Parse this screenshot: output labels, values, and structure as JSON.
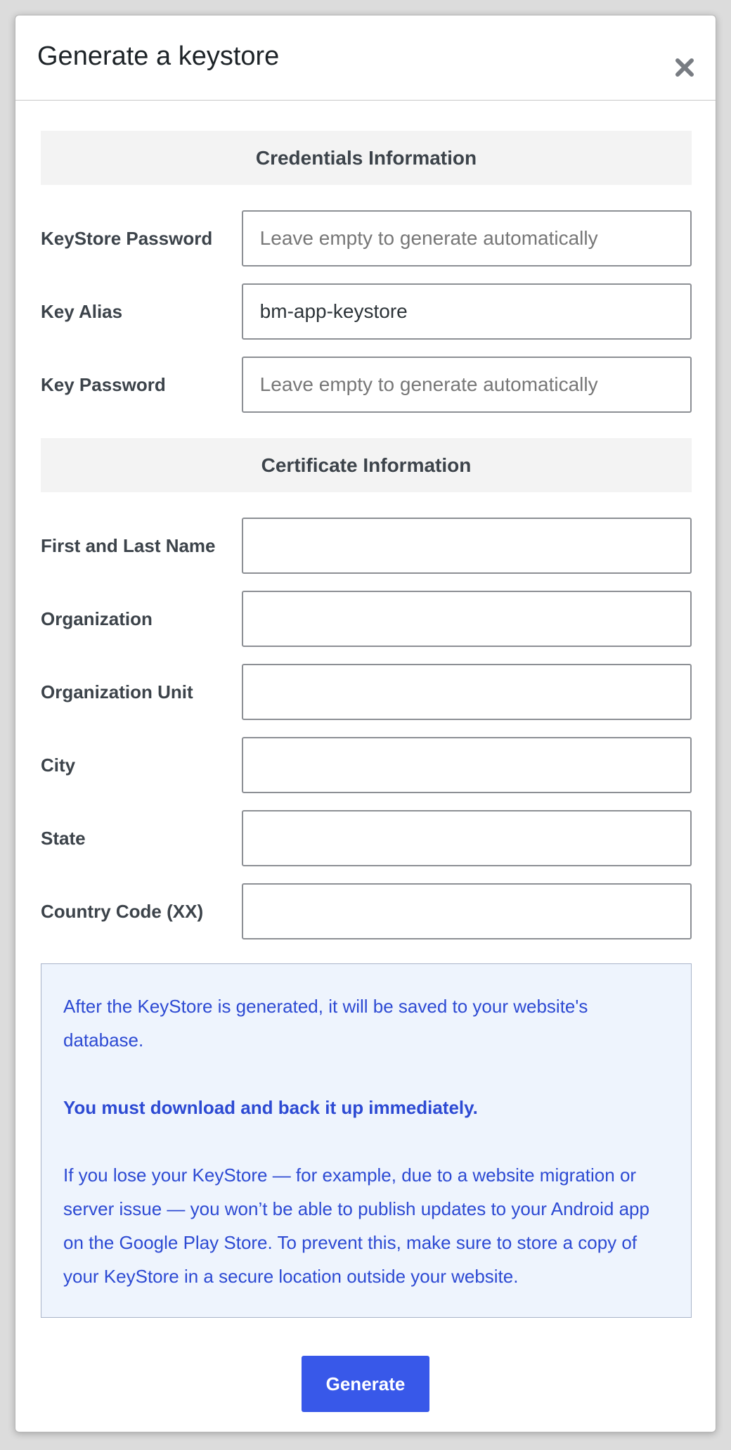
{
  "modal": {
    "title": "Generate a keystore",
    "close_icon": "close-icon"
  },
  "credentials": {
    "heading": "Credentials Information",
    "fields": [
      {
        "label": "KeyStore Password",
        "value": "",
        "placeholder": "Leave empty to generate automatically"
      },
      {
        "label": "Key Alias",
        "value": "bm-app-keystore",
        "placeholder": ""
      },
      {
        "label": "Key Password",
        "value": "",
        "placeholder": "Leave empty to generate automatically"
      }
    ]
  },
  "certificate": {
    "heading": "Certificate Information",
    "fields": [
      {
        "label": "First and Last Name",
        "value": ""
      },
      {
        "label": "Organization",
        "value": ""
      },
      {
        "label": "Organization Unit",
        "value": ""
      },
      {
        "label": "City",
        "value": ""
      },
      {
        "label": "State",
        "value": ""
      },
      {
        "label": "Country Code (XX)",
        "value": ""
      }
    ]
  },
  "notice": {
    "paragraph1": "After the KeyStore is generated, it will be saved to your website's database.",
    "paragraph2": "You must download and back it up immediately.",
    "paragraph3": "If you lose your KeyStore — for example, due to a website migration or server issue — you won’t be able to publish updates to your Android app on the Google Play Store. To prevent this, make sure to store a copy of your KeyStore in a secure location outside your website."
  },
  "footer": {
    "generate_label": "Generate"
  },
  "colors": {
    "accent": "#3858e9",
    "notice_text": "#2d4ad3",
    "notice_bg": "#eef4fd"
  }
}
